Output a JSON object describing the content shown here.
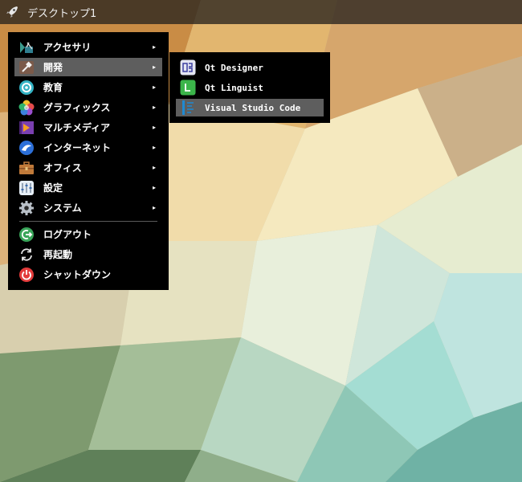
{
  "panel": {
    "workspace_label": "デスクトップ1",
    "launcher_icon": "rocket-icon"
  },
  "menu": {
    "categories": [
      {
        "label": "アクセサリ",
        "icon": "accessories-icon"
      },
      {
        "label": "開発",
        "icon": "development-icon"
      },
      {
        "label": "教育",
        "icon": "education-icon"
      },
      {
        "label": "グラフィックス",
        "icon": "graphics-icon"
      },
      {
        "label": "マルチメディア",
        "icon": "multimedia-icon"
      },
      {
        "label": "インターネット",
        "icon": "internet-icon"
      },
      {
        "label": "オフィス",
        "icon": "office-icon"
      },
      {
        "label": "設定",
        "icon": "settings-icon"
      },
      {
        "label": "システム",
        "icon": "system-icon"
      }
    ],
    "actions": [
      {
        "label": "ログアウト",
        "icon": "logout-icon"
      },
      {
        "label": "再起動",
        "icon": "reboot-icon"
      },
      {
        "label": "シャットダウン",
        "icon": "shutdown-icon"
      }
    ],
    "active_category": "開発",
    "submenu_arrow": "▸"
  },
  "submenu": {
    "items": [
      {
        "label": "Qt Designer",
        "icon": "qt-designer-icon"
      },
      {
        "label": "Qt Linguist",
        "icon": "qt-linguist-icon"
      },
      {
        "label": "Visual Studio Code",
        "icon": "vscode-icon"
      }
    ],
    "active_item": "Visual Studio Code"
  },
  "colors": {
    "menu_background": "#000000",
    "highlight": "#5e5e5e",
    "panel": "#2a231f"
  }
}
